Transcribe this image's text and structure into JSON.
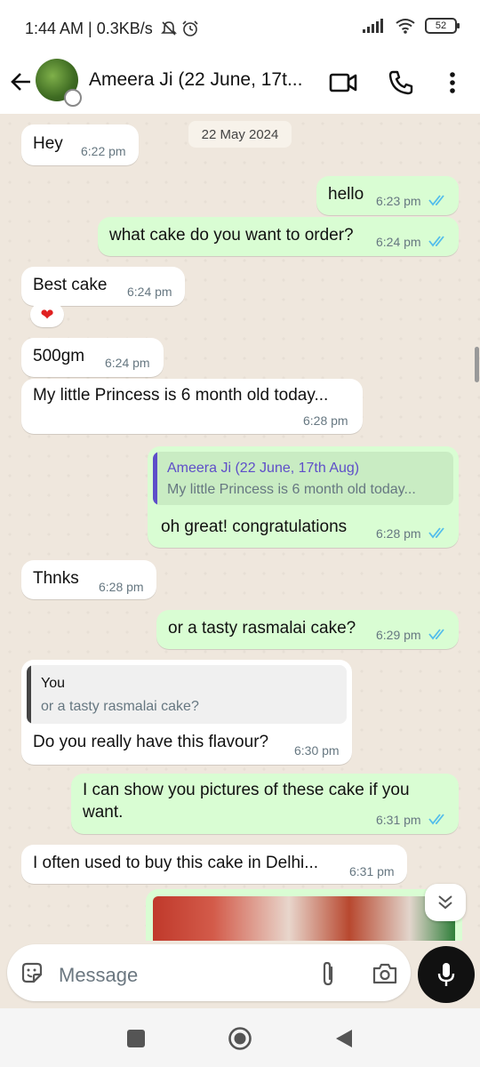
{
  "status_bar": {
    "time": "1:44 AM | 0.3KB/s",
    "battery": "52"
  },
  "header": {
    "contact_name": "Ameera Ji (22 June, 17t..."
  },
  "chat": {
    "date_chip": "22 May 2024",
    "messages": [
      {
        "text": "Hey",
        "time": "6:22 pm"
      },
      {
        "text": "hello",
        "time": "6:23 pm"
      },
      {
        "text": "what cake do you want to order?",
        "time": "6:24 pm"
      },
      {
        "text": "Best cake",
        "time": "6:24 pm",
        "reaction": "❤"
      },
      {
        "text": "500gm",
        "time": "6:24 pm"
      },
      {
        "text": "My little Princess is 6 month old today...",
        "time": "6:28 pm"
      },
      {
        "quote_name": "Ameera Ji (22 June, 17th Aug)",
        "quote_text": "My little Princess is 6 month old today...",
        "text": "oh great! congratulations",
        "time": "6:28 pm"
      },
      {
        "text": "Thnks",
        "time": "6:28 pm"
      },
      {
        "text": "or a tasty rasmalai cake?",
        "time": "6:29 pm"
      },
      {
        "quote_name": "You",
        "quote_text": "or a tasty rasmalai cake?",
        "text": "Do you really have this flavour?",
        "time": "6:30 pm"
      },
      {
        "text_line1": "I can show you pictures of these cake if you",
        "text_line2": "want.",
        "time": "6:31 pm"
      },
      {
        "text": "I often used to buy this cake in Delhi...",
        "time": "6:31 pm"
      }
    ]
  },
  "composer": {
    "placeholder": "Message"
  },
  "colors": {
    "outgoing_bubble": "#d9fdd3",
    "incoming_bubble": "#ffffff",
    "read_ticks": "#53bdeb",
    "quote_bar_contact": "#5e4ec9",
    "quote_bar_you": "#444444"
  },
  "icons": [
    "back-arrow-icon",
    "video-call-icon",
    "voice-call-icon",
    "more-options-icon",
    "sticker-icon",
    "attach-icon",
    "camera-icon",
    "mic-icon",
    "scroll-down-icon",
    "nav-square-icon",
    "nav-home-icon",
    "nav-back-icon"
  ]
}
